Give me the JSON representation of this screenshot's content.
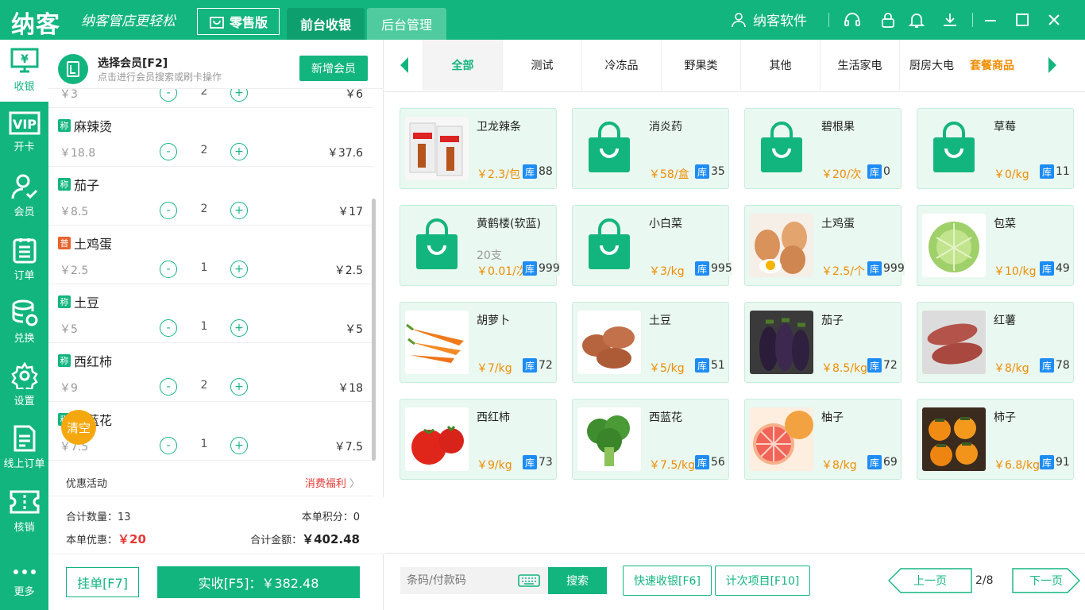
{
  "top": {
    "logo": "纳客",
    "slogan": "纳客管店更轻松",
    "retail": "零售版",
    "tab_front": "前台收银",
    "tab_back": "后台管理",
    "user": "纳客软件"
  },
  "nav": [
    {
      "label": "收银",
      "icon": "cashier-icon"
    },
    {
      "label": "开卡",
      "icon": "vip-icon"
    },
    {
      "label": "会员",
      "icon": "member-icon"
    },
    {
      "label": "订单",
      "icon": "order-icon"
    },
    {
      "label": "兑换",
      "icon": "exchange-icon"
    },
    {
      "label": "设置",
      "icon": "settings-icon"
    },
    {
      "label": "线上订单",
      "icon": "online-order-icon"
    },
    {
      "label": "核销",
      "icon": "verify-icon"
    },
    {
      "label": "更多",
      "icon": "more-icon"
    }
  ],
  "member": {
    "title": "选择会员[F2]",
    "subtitle": "点击进行会员搜索或刷卡操作",
    "add_button": "新增会员"
  },
  "cart": {
    "partial_item": {
      "price": "￥3",
      "qty": "2",
      "total": "￥6"
    },
    "items": [
      {
        "tag": "称",
        "name": "麻辣烫",
        "price": "￥18.8",
        "qty": "2",
        "total": "￥37.6"
      },
      {
        "tag": "称",
        "name": "茄子",
        "price": "￥8.5",
        "qty": "2",
        "total": "￥17"
      },
      {
        "tag": "普",
        "name": "土鸡蛋",
        "price": "￥2.5",
        "qty": "1",
        "total": "￥2.5"
      },
      {
        "tag": "称",
        "name": "土豆",
        "price": "￥5",
        "qty": "1",
        "total": "￥5"
      },
      {
        "tag": "称",
        "name": "西红柿",
        "price": "￥9",
        "qty": "2",
        "total": "￥18"
      },
      {
        "tag": "称",
        "name": "西蓝花",
        "price": "￥7.5",
        "qty": "1",
        "total": "￥7.5"
      }
    ],
    "minus": "-",
    "plus": "+",
    "clear": "清空"
  },
  "promo": {
    "label": "优惠活动",
    "link": "消费福利"
  },
  "summary": {
    "count_label": "合计数量：",
    "count": "13",
    "points_label": "本单积分：",
    "points": "0",
    "discount_label": "本单优惠：",
    "discount": "￥20",
    "total_label": "合计金额：",
    "total": "￥402.48"
  },
  "actions": {
    "hang": "挂单[F7]",
    "pay": "实收[F5]：￥382.48"
  },
  "categories": [
    "全部",
    "测试",
    "冷冻品",
    "野果类",
    "其他",
    "生活家电",
    "厨房大电",
    "套餐商品"
  ],
  "stock_label": "库",
  "products": [
    {
      "name": "卫龙辣条",
      "price": "￥2.3/包",
      "stock": "88",
      "img": "snack"
    },
    {
      "name": "消炎药",
      "price": "￥58/盒",
      "stock": "35",
      "img": "bag"
    },
    {
      "name": "碧根果",
      "price": "￥20/次",
      "stock": "0",
      "img": "bag"
    },
    {
      "name": "草莓",
      "price": "￥0/kg",
      "stock": "11",
      "img": "bag"
    },
    {
      "name": "黄鹤楼(软蓝)",
      "note": "20支",
      "price": "￥0.01/次",
      "stock": "999",
      "img": "bag"
    },
    {
      "name": "小白菜",
      "price": "￥3/kg",
      "stock": "995",
      "img": "bag"
    },
    {
      "name": "土鸡蛋",
      "price": "￥2.5/个",
      "stock": "999",
      "img": "egg"
    },
    {
      "name": "包菜",
      "price": "￥10/kg",
      "stock": "49",
      "img": "cabbage"
    },
    {
      "name": "胡萝卜",
      "price": "￥7/kg",
      "stock": "72",
      "img": "carrot"
    },
    {
      "name": "土豆",
      "price": "￥5/kg",
      "stock": "51",
      "img": "potato"
    },
    {
      "name": "茄子",
      "price": "￥8.5/kg",
      "stock": "72",
      "img": "eggplant"
    },
    {
      "name": "红薯",
      "price": "￥8/kg",
      "stock": "78",
      "img": "sweetpotato"
    },
    {
      "name": "西红柿",
      "price": "￥9/kg",
      "stock": "73",
      "img": "tomato"
    },
    {
      "name": "西蓝花",
      "price": "￥7.5/kg",
      "stock": "56",
      "img": "broccoli"
    },
    {
      "name": "柚子",
      "price": "￥8/kg",
      "stock": "69",
      "img": "grapefruit"
    },
    {
      "name": "柿子",
      "price": "￥6.8/kg",
      "stock": "91",
      "img": "persimmon"
    }
  ],
  "bottom": {
    "search_placeholder": "条码/付款码",
    "search_button": "搜索",
    "quick_cash": "快速收银[F6]",
    "count_item": "计次项目[F10]",
    "prev": "上一页",
    "page": "2/8",
    "next": "下一页"
  },
  "colors": {
    "brand": "#13b57f",
    "price": "#f08c00",
    "stock_badge": "#1e8cf5",
    "discount": "#e53935"
  }
}
